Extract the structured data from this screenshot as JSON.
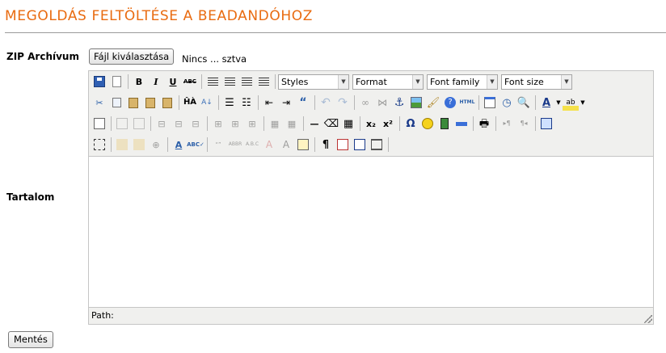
{
  "page": {
    "title": "MEGOLDÁS FELTÖLTÉSE A BEADANDÓHOZ"
  },
  "form": {
    "zip_label": "ZIP Archívum",
    "file_button": "Fájl kiválasztása",
    "file_status": "Nincs ... sztva",
    "content_label": "Tartalom",
    "save_button": "Mentés"
  },
  "editor": {
    "selects": {
      "styles": "Styles",
      "format": "Format",
      "font_family": "Font family",
      "font_size": "Font size"
    },
    "status_path": "Path:"
  },
  "colors": {
    "title": "#e96b10",
    "toolbar_bg": "#f0f0ee"
  }
}
